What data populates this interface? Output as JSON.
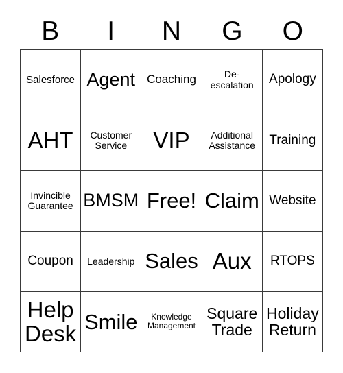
{
  "header": {
    "letters": [
      "B",
      "I",
      "N",
      "G",
      "O"
    ]
  },
  "colors": {
    "background": "#ffffff",
    "text": "#000000",
    "grid_line": "#3a3a3a"
  },
  "grid": {
    "columns": 5,
    "rows": 5,
    "cells": [
      {
        "text": "Salesforce",
        "size": "sm"
      },
      {
        "text": "Agent",
        "size": "xl"
      },
      {
        "text": "Coaching",
        "size": "m"
      },
      {
        "text": "De-\nescalation",
        "size": "s"
      },
      {
        "text": "Apology",
        "size": "ml"
      },
      {
        "text": "AHT",
        "size": "3xl"
      },
      {
        "text": "Customer\nService",
        "size": "s"
      },
      {
        "text": "VIP",
        "size": "3xl"
      },
      {
        "text": "Additional\nAssistance",
        "size": "s"
      },
      {
        "text": "Training",
        "size": "ml"
      },
      {
        "text": "Invincible\nGuarantee",
        "size": "s"
      },
      {
        "text": "BMSM",
        "size": "xl"
      },
      {
        "text": "Free!",
        "size": "xxl"
      },
      {
        "text": "Claim",
        "size": "xxl"
      },
      {
        "text": "Website",
        "size": "ml"
      },
      {
        "text": "Coupon",
        "size": "ml"
      },
      {
        "text": "Leadership",
        "size": "s"
      },
      {
        "text": "Sales",
        "size": "xxl"
      },
      {
        "text": "Aux",
        "size": "3xl"
      },
      {
        "text": "RTOPS",
        "size": "ml"
      },
      {
        "text": "Help\nDesk",
        "size": "3xl"
      },
      {
        "text": "Smile",
        "size": "xxl"
      },
      {
        "text": "Knowledge\nManagement",
        "size": "xs"
      },
      {
        "text": "Square\nTrade",
        "size": "l"
      },
      {
        "text": "Holiday\nReturn",
        "size": "l"
      }
    ]
  }
}
